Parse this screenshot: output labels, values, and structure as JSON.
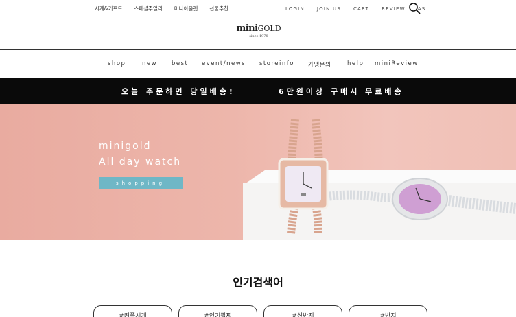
{
  "utility_nav": {
    "left": [
      "시계&기프트",
      "스페셜주얼리",
      "미니아울렛",
      "선물추천"
    ],
    "right": [
      "LOGIN",
      "JOIN US",
      "CART",
      "REVIEW",
      "AS"
    ]
  },
  "logo": {
    "brand_main": "mini",
    "brand_sub": "GOLD",
    "since": "since 1978"
  },
  "main_nav": [
    "shop",
    "new",
    "best",
    "event/news",
    "storeinfo",
    "가맹문의",
    "help",
    "miniReview"
  ],
  "notice": {
    "left": "오늘 주문하면 당일배송!",
    "right": "6만원이상 구매시 무료배송",
    "background": "#0a0a0a"
  },
  "hero": {
    "line1": "minigold",
    "line2": "All day watch",
    "button": "shopping",
    "button_color": "#6fb7c6",
    "background": "#edb6ab"
  },
  "popular": {
    "title": "인기검색어",
    "chips": [
      "#커플시계",
      "#인기팔찌",
      "#신반지",
      "#반지"
    ]
  }
}
